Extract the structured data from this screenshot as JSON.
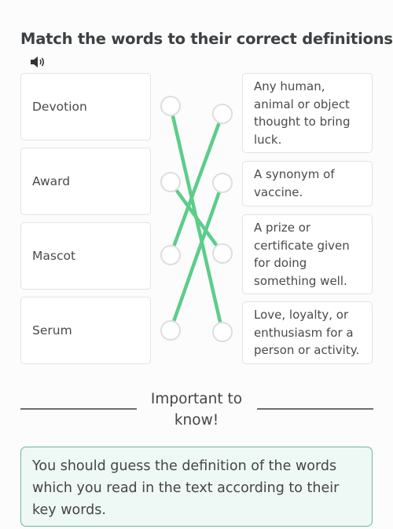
{
  "title": "Match the words to their correct definitions.",
  "audio_icon": "speaker-icon",
  "words": [
    {
      "label": "Devotion"
    },
    {
      "label": "Award"
    },
    {
      "label": "Mascot"
    },
    {
      "label": "Serum"
    }
  ],
  "definitions": [
    {
      "label": "Any human, animal or object thought to bring luck."
    },
    {
      "label": "A synonym of vaccine."
    },
    {
      "label": "A prize or certificate given for doing something well."
    },
    {
      "label": "Love, loyalty, or enthusiasm for a person or activity."
    }
  ],
  "matches": [
    {
      "word_index": 0,
      "definition_index": 3
    },
    {
      "word_index": 2,
      "definition_index": 0
    },
    {
      "word_index": 1,
      "definition_index": 2
    },
    {
      "word_index": 3,
      "definition_index": 1
    }
  ],
  "colors": {
    "connector": "#5ccd8a",
    "node_border": "#dedede",
    "note_background": "#eef8f4",
    "note_border": "#6fb59a"
  },
  "important": {
    "heading": "Important to know!",
    "note": "You should guess the definition of the words which you read in the text according to their key words."
  }
}
